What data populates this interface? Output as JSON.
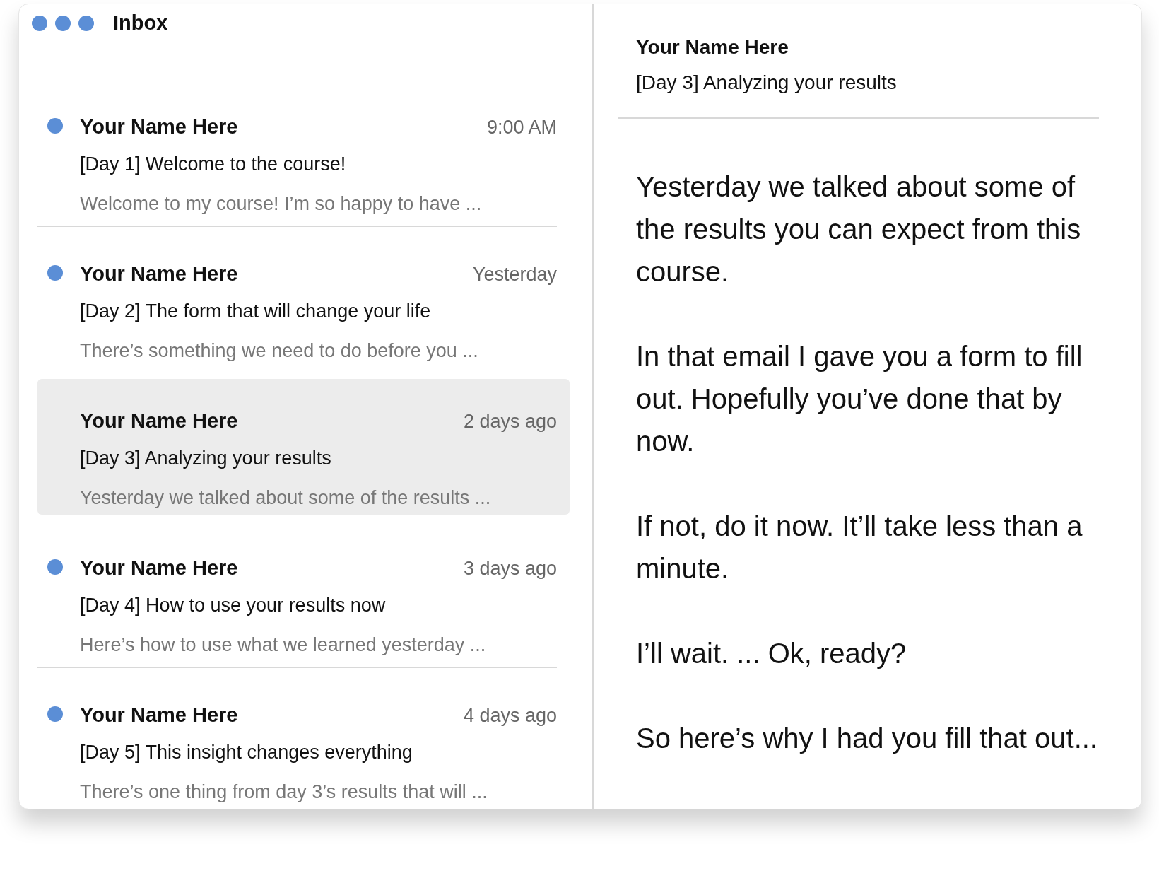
{
  "window": {
    "title": "Inbox"
  },
  "messages": [
    {
      "sender": "Your Name Here",
      "time": "9:00 AM",
      "subject": "[Day 1] Welcome to the course!",
      "preview": "Welcome to my course! I’m so happy to have ...",
      "unread": true,
      "selected": false
    },
    {
      "sender": "Your Name Here",
      "time": "Yesterday",
      "subject": "[Day 2] The form that will change your life",
      "preview": "There’s something we need to do before you ...",
      "unread": true,
      "selected": false
    },
    {
      "sender": "Your Name Here",
      "time": "2 days ago",
      "subject": "[Day 3] Analyzing your results",
      "preview": "Yesterday we talked about some of the results ...",
      "unread": false,
      "selected": true
    },
    {
      "sender": "Your Name Here",
      "time": "3 days ago",
      "subject": "[Day 4] How to use your results now",
      "preview": "Here’s how to use what we learned yesterday ...",
      "unread": true,
      "selected": false
    },
    {
      "sender": "Your Name Here",
      "time": "4 days ago",
      "subject": "[Day 5] This insight changes everything",
      "preview": "There’s one thing from day 3’s results that will ...",
      "unread": true,
      "selected": false
    }
  ],
  "reader": {
    "sender": "Your Name Here",
    "subject": "[Day 3] Analyzing your results",
    "paragraphs": [
      "Yesterday we talked about some of the results you can expect from this course.",
      "In that email I gave you a form to fill out. Hopefully you’ve done that by now.",
      "If not, do it now. It’ll take less than a minute.",
      "I’ll wait. ... Ok, ready?",
      "So here’s why I had you fill that out..."
    ]
  }
}
